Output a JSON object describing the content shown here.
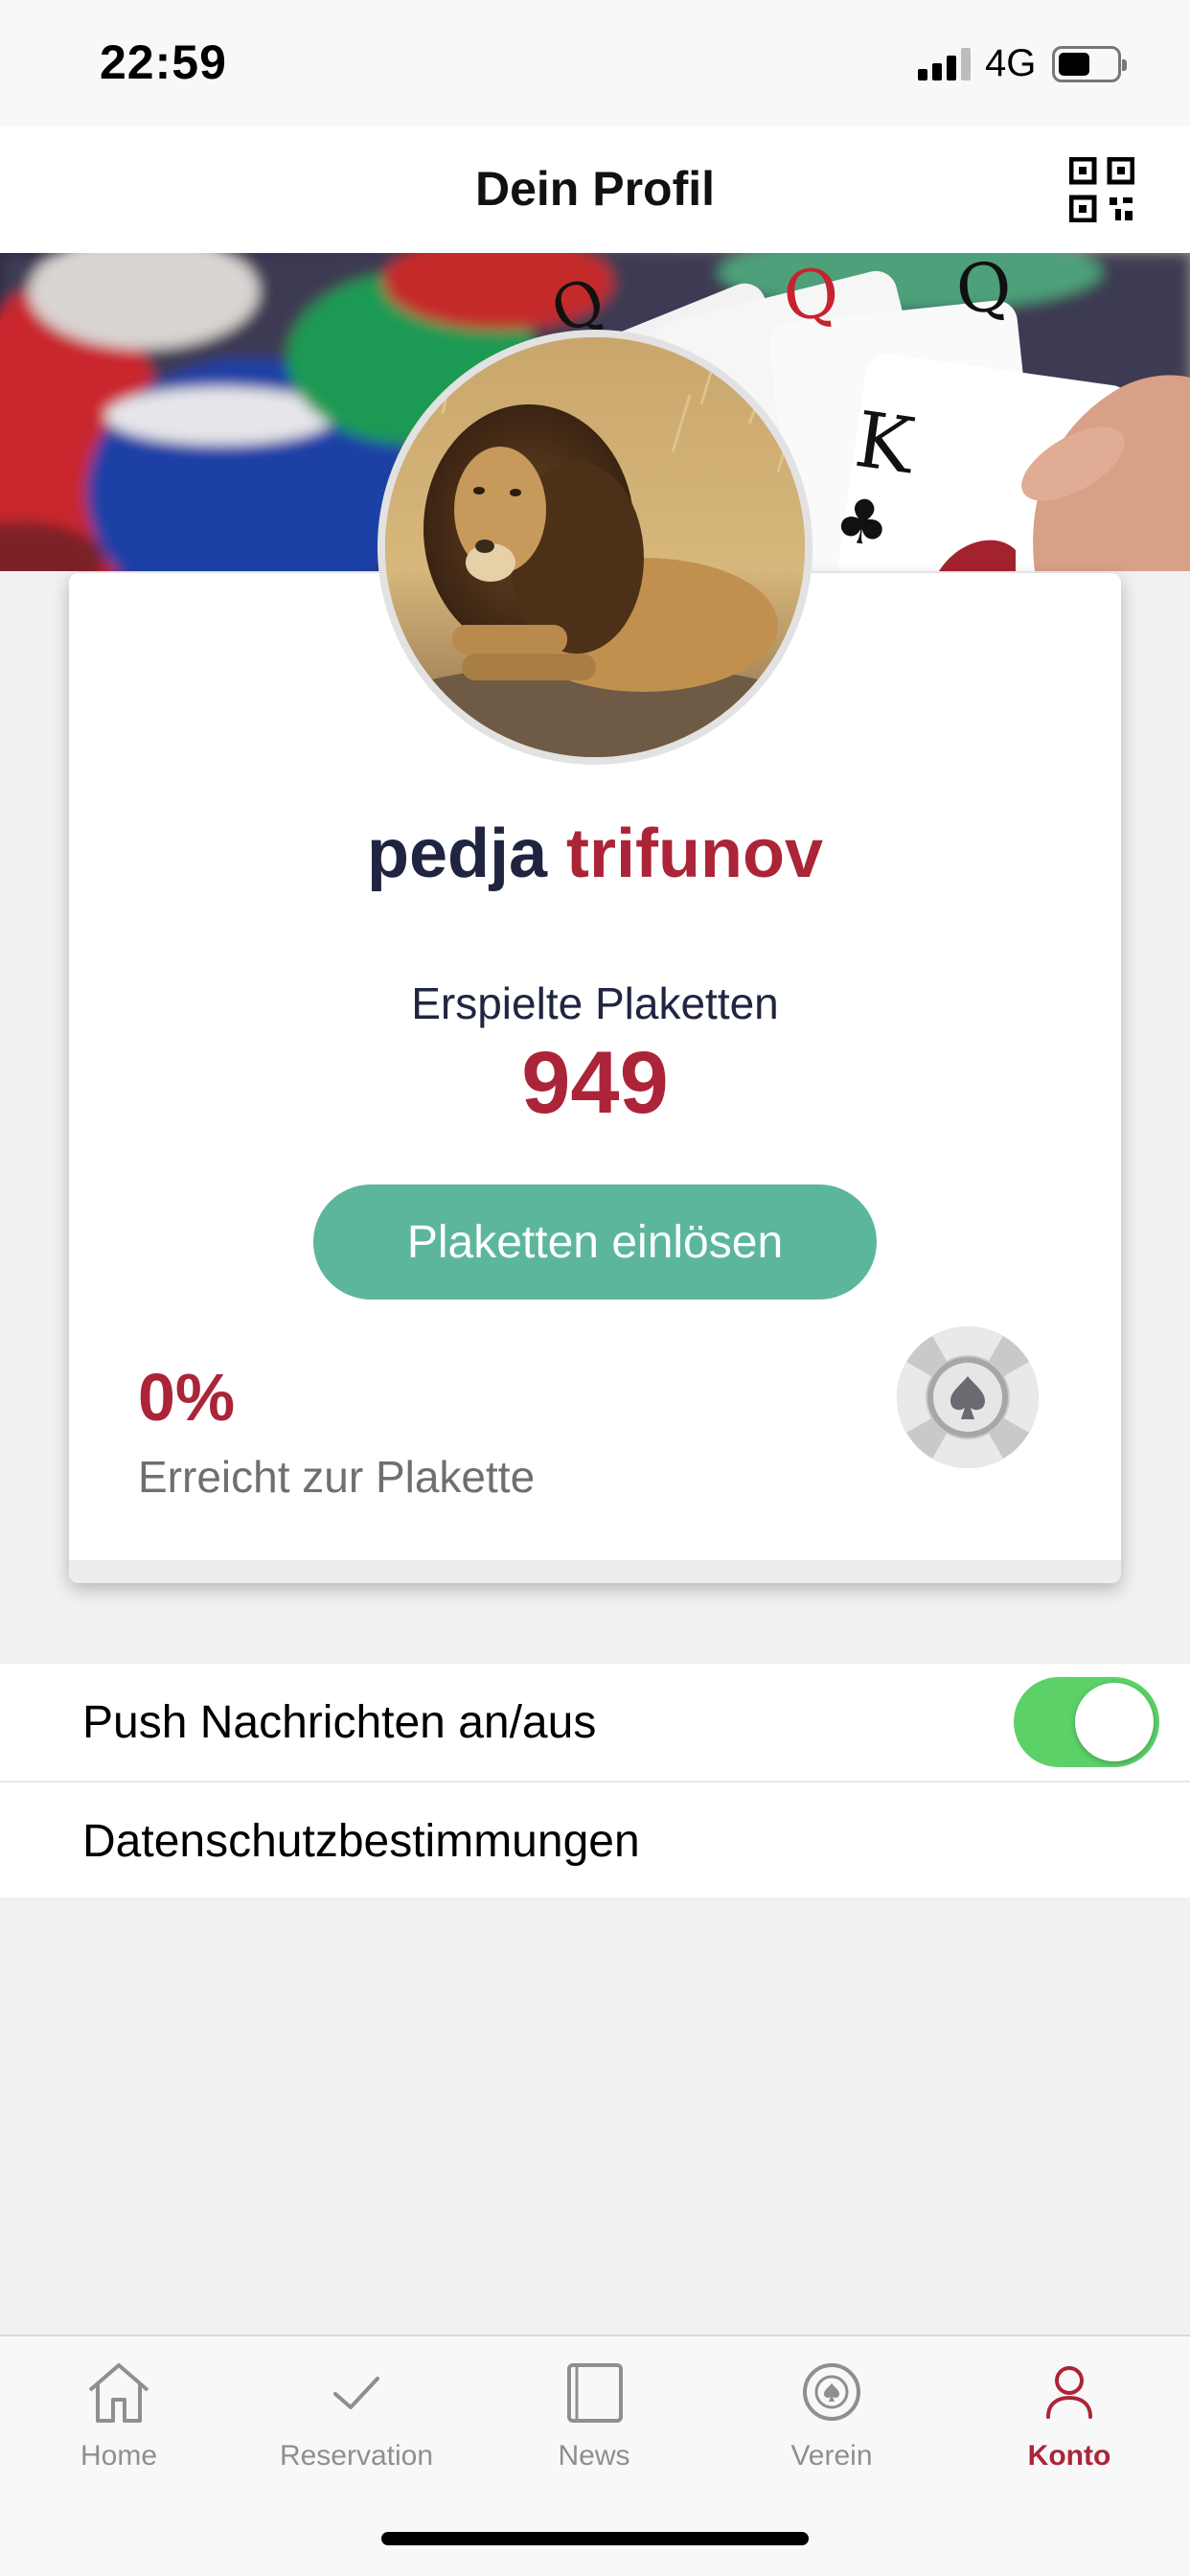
{
  "status_bar": {
    "time": "22:59",
    "network": "4G",
    "signal_bars": 3,
    "battery_level": 0.55
  },
  "nav": {
    "title": "Dein Profil",
    "qr_icon": "qr-code-icon"
  },
  "profile": {
    "first_name": "pedja",
    "last_name": "trifunov",
    "badges_label": "Erspielte Plaketten",
    "badges_count": "949",
    "redeem_label": "Plaketten einlösen",
    "progress_percent": "0%",
    "progress_label": "Erreicht zur Plakette",
    "chip_icon": "poker-chip-spade-icon"
  },
  "settings": {
    "push_label": "Push Nachrichten an/aus",
    "push_enabled": true,
    "privacy_label": "Datenschutzbestimmungen"
  },
  "tabs": [
    {
      "label": "Home",
      "icon": "home-icon",
      "active": false
    },
    {
      "label": "Reservation",
      "icon": "checkmark-icon",
      "active": false
    },
    {
      "label": "News",
      "icon": "news-icon",
      "active": false
    },
    {
      "label": "Verein",
      "icon": "chip-icon",
      "active": false
    },
    {
      "label": "Konto",
      "icon": "person-icon",
      "active": true
    }
  ],
  "colors": {
    "accent_red": "#ab2438",
    "navy": "#1f2440",
    "button_green": "#5cb69c",
    "toggle_green": "#5bd168",
    "inactive_gray": "#8e8e93"
  }
}
